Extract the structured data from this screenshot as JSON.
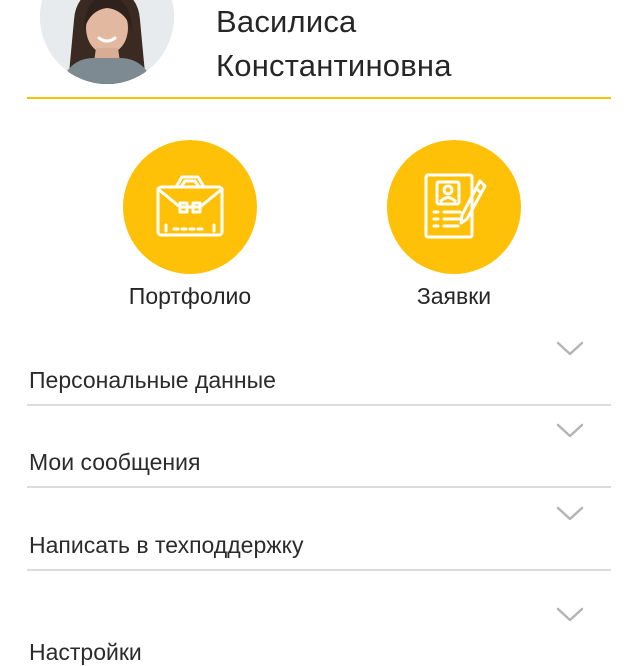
{
  "profile": {
    "first_name": "Василиса",
    "patronymic": "Константиновна"
  },
  "tiles": [
    {
      "label": "Портфолио",
      "icon": "briefcase-icon"
    },
    {
      "label": "Заявки",
      "icon": "resume-document-icon"
    }
  ],
  "menu": [
    {
      "label": "Персональные данные",
      "icon": "chevron-down-icon"
    },
    {
      "label": "Мои сообщения",
      "icon": "chevron-down-icon"
    },
    {
      "label": "Написать в техподдержку",
      "icon": "chevron-down-icon"
    },
    {
      "label": "Настройки",
      "icon": "chevron-down-icon"
    }
  ],
  "colors": {
    "accent": "#FFC107",
    "divider": "#DCDCDC",
    "chevron": "#B5B5B5",
    "text": "#262626"
  }
}
